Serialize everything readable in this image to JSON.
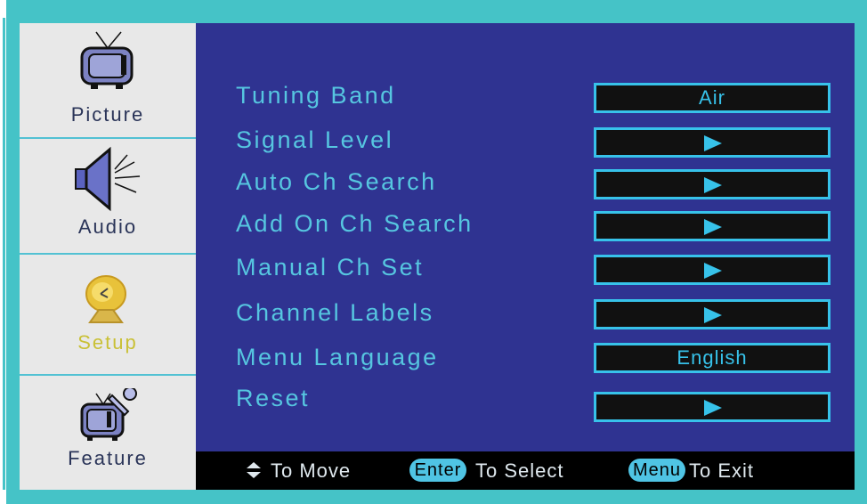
{
  "sidebar": {
    "items": [
      {
        "label": "Picture",
        "icon": "tv-icon",
        "active": false
      },
      {
        "label": "Audio",
        "icon": "speaker-icon",
        "active": false
      },
      {
        "label": "Setup",
        "icon": "satellite-dish-icon",
        "active": true
      },
      {
        "label": "Feature",
        "icon": "tv-wrench-icon",
        "active": false
      }
    ]
  },
  "menu": {
    "items": [
      {
        "label": "Tuning Band",
        "value": "Air"
      },
      {
        "label": "Signal Level",
        "value": ""
      },
      {
        "label": "Auto Ch Search",
        "value": ""
      },
      {
        "label": "Add On Ch Search",
        "value": ""
      },
      {
        "label": "Manual Ch Set",
        "value": ""
      },
      {
        "label": "Channel Labels",
        "value": ""
      },
      {
        "label": "Menu Language",
        "value": "English"
      },
      {
        "label": "Reset",
        "value": ""
      }
    ]
  },
  "footer": {
    "move_text": "To Move",
    "enter_key": "Enter",
    "select_text": "To Select",
    "menu_key": "Menu",
    "exit_text": "To Exit"
  },
  "colors": {
    "frame": "#45c3c7",
    "panel": "#2f3391",
    "menu_text": "#56c6e0",
    "box_border": "#37c2ea",
    "active_label": "#c9c035"
  }
}
